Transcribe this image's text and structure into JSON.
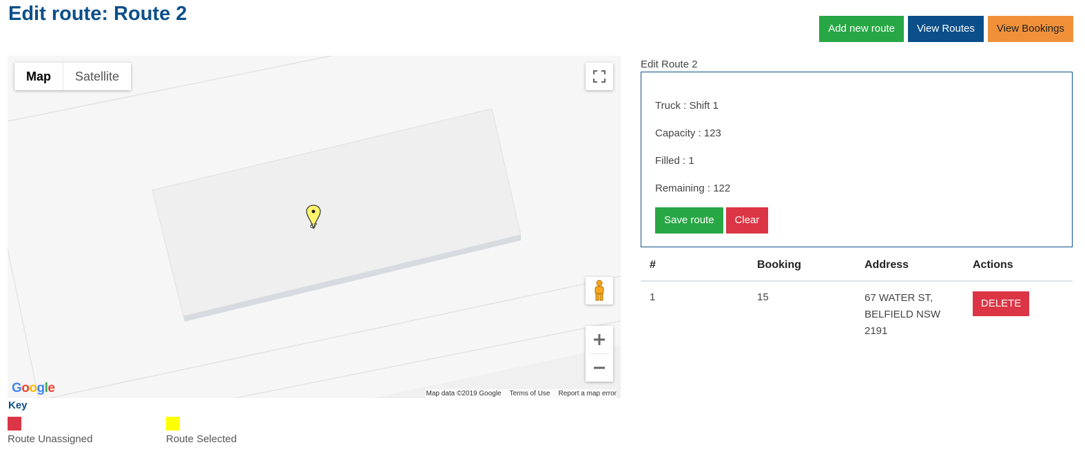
{
  "page": {
    "title": "Edit route: Route 2"
  },
  "top_actions": {
    "add_new_route": "Add new route",
    "view_routes": "View Routes",
    "view_bookings": "View Bookings"
  },
  "map": {
    "type_map": "Map",
    "type_satellite": "Satellite",
    "marker_label": "67",
    "google_logo": [
      "G",
      "o",
      "o",
      "g",
      "l",
      "e"
    ],
    "footer_data": "Map data ©2019 Google",
    "footer_terms": "Terms of Use",
    "footer_report": "Report a map error"
  },
  "key": {
    "title": "Key",
    "unassigned_label": "Route Unassigned",
    "selected_label": "Route Selected",
    "unassigned_color": "#dc3545",
    "selected_color": "#ffff00"
  },
  "panel": {
    "caption": "Edit Route 2",
    "truck": "Truck : Shift 1",
    "capacity": "Capacity : 123",
    "filled": "Filled : 1",
    "remaining": "Remaining : 122",
    "save_label": "Save route",
    "clear_label": "Clear"
  },
  "table": {
    "headers": [
      "#",
      "Booking",
      "Address",
      "Actions"
    ],
    "rows": [
      {
        "num": "1",
        "booking": "15",
        "address_lines": [
          "67 WATER ST,",
          "BELFIELD NSW",
          "2191"
        ],
        "action_label": "DELETE"
      }
    ]
  },
  "colors": {
    "title_blue": "#0b4f8a",
    "green": "#28a745",
    "orange": "#f0913a",
    "red": "#dc3545"
  }
}
